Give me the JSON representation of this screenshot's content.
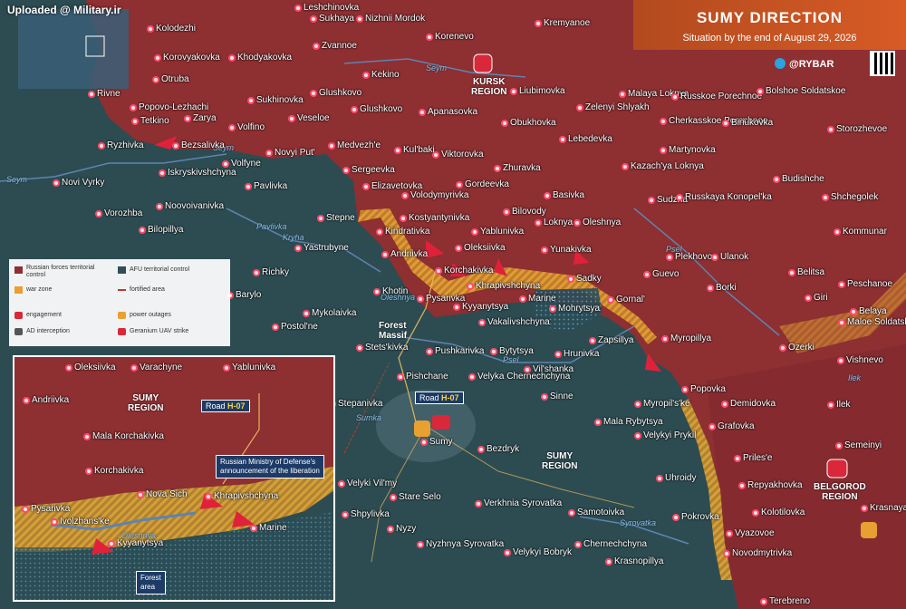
{
  "watermark": "Uploaded @ Military.ir",
  "header": {
    "title": "SUMY DIRECTION",
    "subtitle": "Situation by the end of August 29, 2026",
    "brand": "@RYBAR"
  },
  "colors": {
    "russian_territory": "#8e2f32",
    "afu_territory": "#2f5055",
    "war_zone": "#e8a030",
    "engagement": "#d9283a",
    "title_bar": "#c9521f"
  },
  "regions": {
    "kursk": "KURSK\nREGION",
    "sumy": "SUMY\nREGION",
    "belgorod": "BELGOROD\nREGION",
    "inset_sumy": "SUMY\nREGION"
  },
  "rivers": [
    "Seym",
    "Seym",
    "Seym",
    "Pavlivka",
    "Kryha",
    "Oleshnya",
    "Psel",
    "Psel",
    "Sumka",
    "Syrovatka",
    "Ilek",
    "Oleshnya"
  ],
  "places": [
    "Leshchinovka",
    "Sukhaya",
    "Nizhnii Mordok",
    "Kolodezhi",
    "Zvannoe",
    "Korenevo",
    "Kremyanoe",
    "Korovyakovka",
    "Khodyakovka",
    "Kekino",
    "Otruba",
    "Popovo-Lezhachi",
    "Sukhinovka",
    "Glushkovo",
    "Rivne",
    "Tetkino",
    "Zarya",
    "Volfino",
    "Veseloe",
    "Glushkovo",
    "Apanasovka",
    "Liubimovka",
    "Malaya Loknya",
    "Zelenyi Shlyakh",
    "Russkoe Porechnoe",
    "Bolshoe Soldatskoe",
    "Ryzhivka",
    "Bezsalivka",
    "Medvezh'e",
    "Kul'baki",
    "Obukhovka",
    "Lebedevka",
    "Cherkasskoe Porechnoe",
    "Biriukovka",
    "Storozhevoe",
    "Volfyne",
    "Novyi Put'",
    "Iskryskivshchyna",
    "Sergeevka",
    "Viktorovka",
    "Zhuravka",
    "Martynovka",
    "Kazach'ya Loknya",
    "Novi Vyrky",
    "Pavlivka",
    "Elizavetovka",
    "Gordeevka",
    "Basivka",
    "Budishche",
    "Noovoivanivka",
    "Volodymyrivka",
    "Sudzha",
    "Russkaya Konopel'ka",
    "Shchegolek",
    "Vorozhba",
    "Stepne",
    "Kostyantynivka",
    "Bilovody",
    "Oleshnya",
    "Loknya",
    "Kommunar",
    "Bilopillya",
    "Yablunivka",
    "Kindrativka",
    "Yastrubyne",
    "Oleksiivka",
    "Yunakivka",
    "Plekhovo",
    "Ulanok",
    "Andriivka",
    "Korchakivka",
    "Sadky",
    "Guevo",
    "Belitsa",
    "Richky",
    "Khrapivshchyna",
    "Borki",
    "Peschanoe",
    "Barylo",
    "Khotin",
    "Pysarivka",
    "Marine",
    "Gornal'",
    "Giri",
    "Mykolaivka",
    "Kyyanytsya",
    "Mohrytsya",
    "Belaya",
    "Postol'ne",
    "Vakalivshchyna",
    "Myropillya",
    "Maloe Soldatskoe",
    "Zapsillya",
    "Stets'kivka",
    "Pushkarivka",
    "Bytytsya",
    "Hrunivka",
    "Ozerki",
    "Vishnevo",
    "Pishchane",
    "Vil'shanka",
    "Velyka Chernechchyna",
    "Popovka",
    "Sinne",
    "Demidovka",
    "Stepanivka",
    "Myropil's'ke",
    "Ilek",
    "Grafovka",
    "Mala Rybytsya",
    "Velykyi Prykil",
    "Semeinyi",
    "Sumy",
    "Bezdryk",
    "Priles'e",
    "Uhroidy",
    "Repyakhovka",
    "Velyki Vil'my",
    "Stare Selo",
    "Verkhnia Syrovatka",
    "Kolotilovka",
    "Shpylivka",
    "Samotoivka",
    "Pokrovka",
    "Vyazovoe",
    "Krasnaya Yaruga",
    "Nyzy",
    "Chernechchyna",
    "Novodmytrivka",
    "Nyzhnya Syrovatka",
    "Velykyi Bobryk",
    "Krasnopillya",
    "Terebreno"
  ],
  "map_labels": {
    "forest_massif": "Forest\nMassif"
  },
  "legend": {
    "items": [
      {
        "label": "Russian forces territorial control",
        "color": "#8e2f32"
      },
      {
        "label": "AFU territorial control",
        "color": "#2f5055"
      },
      {
        "label": "war zone",
        "color": "#e8a030"
      },
      {
        "label": "fortified area",
        "color": "#c0392b"
      },
      {
        "label": "engagement",
        "color": "#d9283a"
      },
      {
        "label": "power outages",
        "color": "#e8a030"
      },
      {
        "label": "AD interception",
        "color": "#555555"
      },
      {
        "label": "Geranium UAV strike",
        "color": "#d9283a"
      }
    ]
  },
  "road_tags": [
    {
      "prefix": "Road ",
      "id": "H-07"
    },
    {
      "prefix": "Road ",
      "id": "H-07"
    }
  ],
  "inset": {
    "places": [
      "Oleksiivka",
      "Varachyne",
      "Yablunivka",
      "Andriivka",
      "Mala Korchakivka",
      "Korchakivka",
      "Nova Sich",
      "Khrapivshchyna",
      "Pysarivka",
      "Ivolzhans'ke",
      "Kyyanytsya",
      "Marine"
    ],
    "river": "Oleshnya",
    "mod_note": "Russian Ministry of Defense's\nannouncement of the liberation",
    "forest_note": "Forest\narea"
  }
}
